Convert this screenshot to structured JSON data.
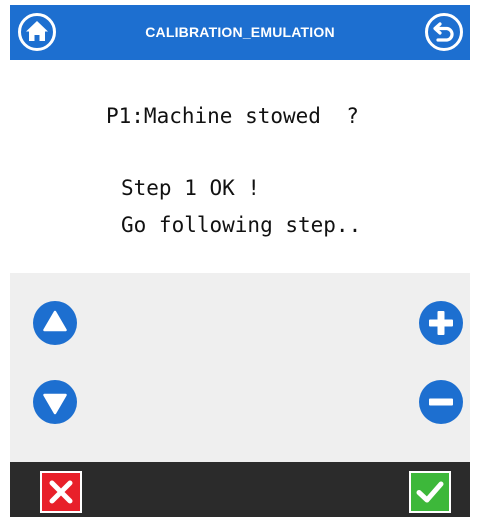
{
  "header": {
    "title": "CALIBRATION_EMULATION",
    "home_icon": "home-icon",
    "back_icon": "back-arrow-icon",
    "color": "#1d6fd0"
  },
  "message": {
    "question": "P1:Machine stowed  ?",
    "status_line1": "Step 1 OK !",
    "status_line2": "Go following step.."
  },
  "controls": {
    "up_icon": "arrow-up-icon",
    "down_icon": "arrow-down-icon",
    "plus_icon": "plus-icon",
    "minus_icon": "minus-icon",
    "color": "#1d6fd0"
  },
  "footer": {
    "cancel_icon": "cancel-x-icon",
    "confirm_icon": "confirm-check-icon",
    "cancel_color": "#e8202a",
    "confirm_color": "#3db83a"
  }
}
